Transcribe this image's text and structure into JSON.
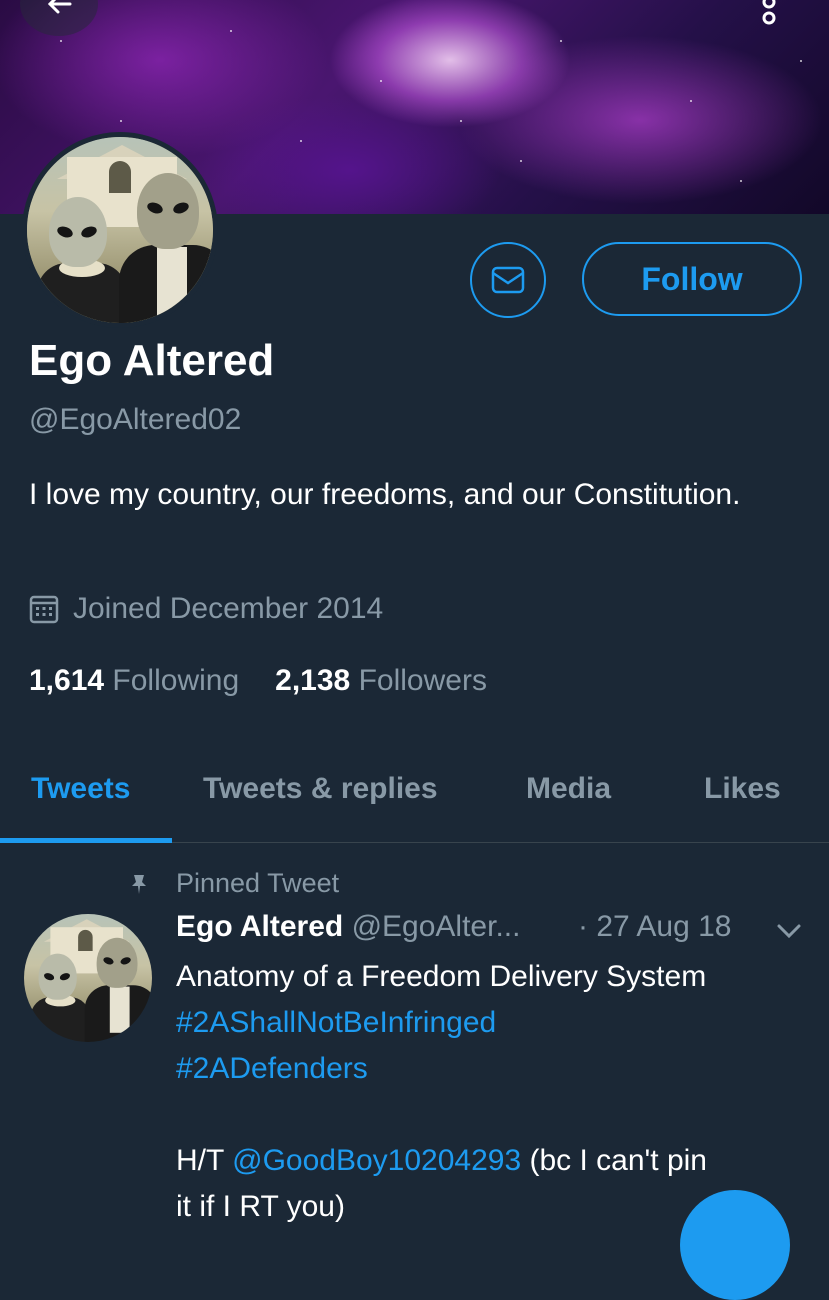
{
  "profile": {
    "name": "Ego Altered",
    "handle": "@EgoAltered02",
    "bio": "I love my country, our freedoms, and our Constitution.",
    "joined": "Joined December 2014",
    "following_count": "1,614",
    "following_label": "Following",
    "followers_count": "2,138",
    "followers_label": "Followers"
  },
  "actions": {
    "follow_label": "Follow",
    "message_icon": "mail-icon"
  },
  "tabs": [
    {
      "label": "Tweets",
      "active": true
    },
    {
      "label": "Tweets & replies",
      "active": false
    },
    {
      "label": "Media",
      "active": false
    },
    {
      "label": "Likes",
      "active": false
    }
  ],
  "pinned_tweet": {
    "pinned_label": "Pinned Tweet",
    "author_name": "Ego Altered",
    "author_handle": "@EgoAlter...",
    "date": "· 27 Aug 18",
    "line1": "Anatomy of a Freedom Delivery System",
    "hashtag1": "#2AShallNotBeInfringed",
    "hashtag2": "#2ADefenders",
    "ht_prefix": "H/T",
    "mention": "@GoodBoy10204293",
    "ht_suffix": "(bc I can't pin",
    "cut_line": "it if I RT you)"
  },
  "colors": {
    "accent": "#1d9bf0",
    "background": "#1b2836",
    "muted": "#8899a6"
  }
}
